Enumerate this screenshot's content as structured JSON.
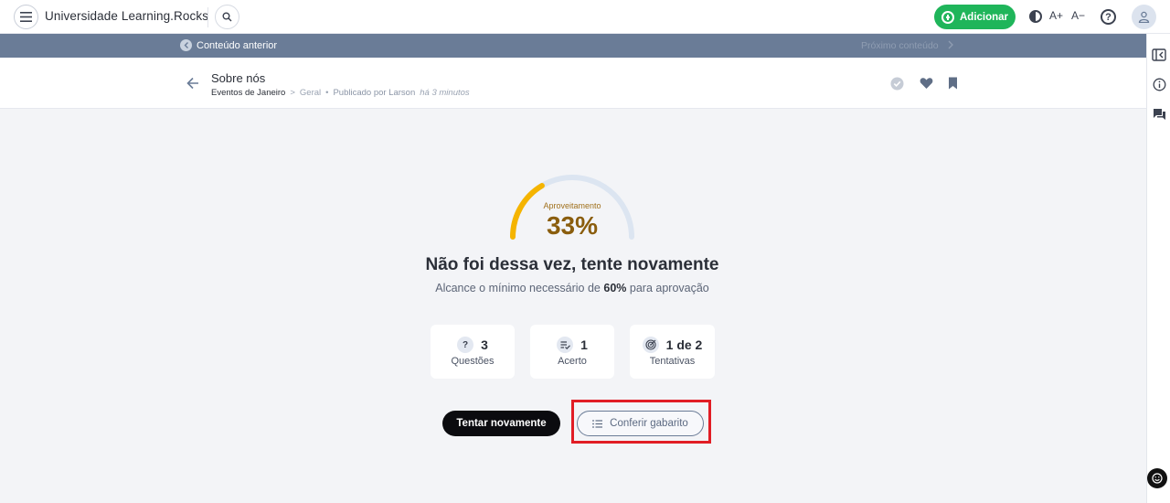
{
  "topbar": {
    "brand": "Universidade Learning.Rocks",
    "add_label": "Adicionar",
    "font_increase": "A+",
    "font_decrease": "A−",
    "help_glyph": "?",
    "icons": [
      "menu-icon",
      "search-icon",
      "contrast-icon",
      "help-icon",
      "user-icon"
    ]
  },
  "navstrip": {
    "prev_label": "Conteúdo anterior",
    "next_label": "Próximo conteúdo"
  },
  "header": {
    "title": "Sobre nós",
    "breadcrumb": {
      "channel": "Eventos de Janeiro",
      "separator": ">",
      "category": "Geral",
      "dot": "•",
      "published_by": "Publicado por Larson",
      "time": "há 3 minutos"
    }
  },
  "result": {
    "gauge_label": "Aproveitamento",
    "gauge_value": "33%",
    "gauge_fraction": 0.33,
    "title": "Não foi dessa vez, tente novamente",
    "sub_prefix": "Alcance o mínimo necessário de",
    "sub_min": "60%",
    "sub_suffix": "para aprovação"
  },
  "stats": [
    {
      "value": "3",
      "label": "Questões",
      "icon": "question-icon",
      "glyph": "?"
    },
    {
      "value": "1",
      "label": "Acerto",
      "icon": "check-list-icon"
    },
    {
      "value": "1 de 2",
      "label": "Tentativas",
      "icon": "target-icon"
    }
  ],
  "actions": {
    "retry_label": "Tentar novamente",
    "answers_label": "Conferir gabarito"
  },
  "colors": {
    "accent_green": "#1fb55a",
    "nav_strip": "#6a7c97",
    "gauge_fill": "#f5b400",
    "gauge_track": "#dce5f1",
    "highlight": "#e11d25"
  }
}
